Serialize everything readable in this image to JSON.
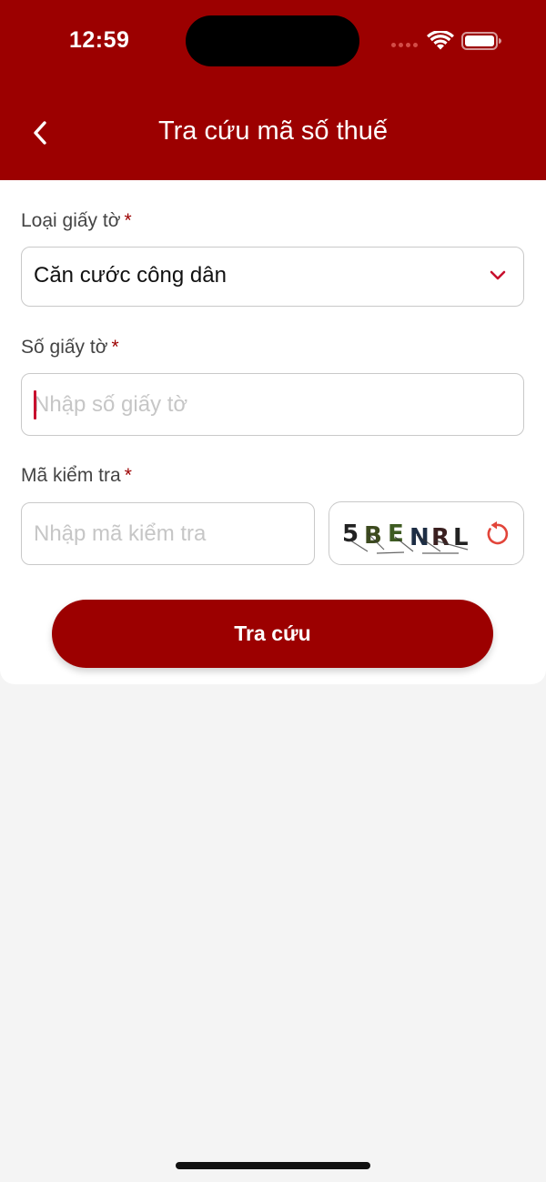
{
  "status_bar": {
    "time": "12:59"
  },
  "header": {
    "title": "Tra cứu mã số thuế"
  },
  "form": {
    "doc_type": {
      "label": "Loại giấy tờ",
      "required_mark": "*",
      "value": "Căn cước công dân"
    },
    "doc_number": {
      "label": "Số giấy tờ",
      "required_mark": "*",
      "placeholder": "Nhập số giấy tờ"
    },
    "captcha": {
      "label": "Mã kiểm tra",
      "required_mark": "*",
      "placeholder": "Nhập mã kiểm tra",
      "code": "5BENRL"
    },
    "submit_label": "Tra cứu"
  },
  "colors": {
    "brand": "#9c0000",
    "accent": "#c8102e",
    "background": "#f4f4f4"
  },
  "icons": [
    "back-chevron-icon",
    "chevron-down-icon",
    "refresh-icon",
    "wifi-icon",
    "battery-icon",
    "signal-icon"
  ]
}
